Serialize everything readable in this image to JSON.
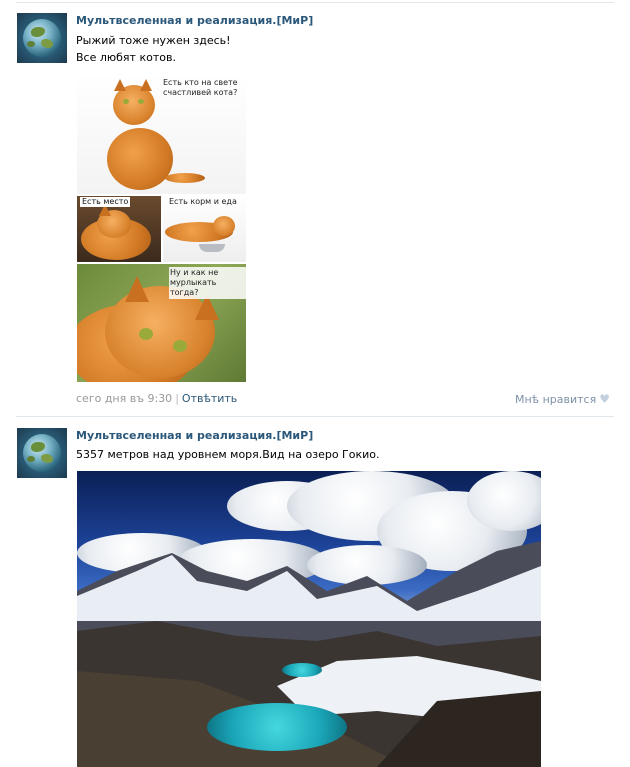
{
  "posts": [
    {
      "author": "Мультвселенная и реализация.[МиР]",
      "lines": [
        "Рыжий тоже нужен здесь!",
        "Все любят котов."
      ],
      "image": {
        "captions": [
          "Есть кто на свете счастливей кота?",
          "Есть место",
          "Есть корм и еда",
          "Ну и как не мурлыкать тогда?"
        ]
      },
      "timestamp": "сего дня въ 9:30",
      "divider": "|",
      "reply": "Отвѣтить",
      "like": "Мнѣ нравится"
    },
    {
      "author": "Мультвселенная и реализация.[МиР]",
      "lines": [
        "5357 метров над уровнем моря.Вид на озеро Гокио."
      ]
    }
  ],
  "colors": {
    "link": "#2b587a",
    "meta": "#999999",
    "like": "#7f92a8",
    "separator": "#dfe6ec"
  },
  "icons": {
    "avatar": "globe-avatar",
    "like": "heart-icon"
  }
}
